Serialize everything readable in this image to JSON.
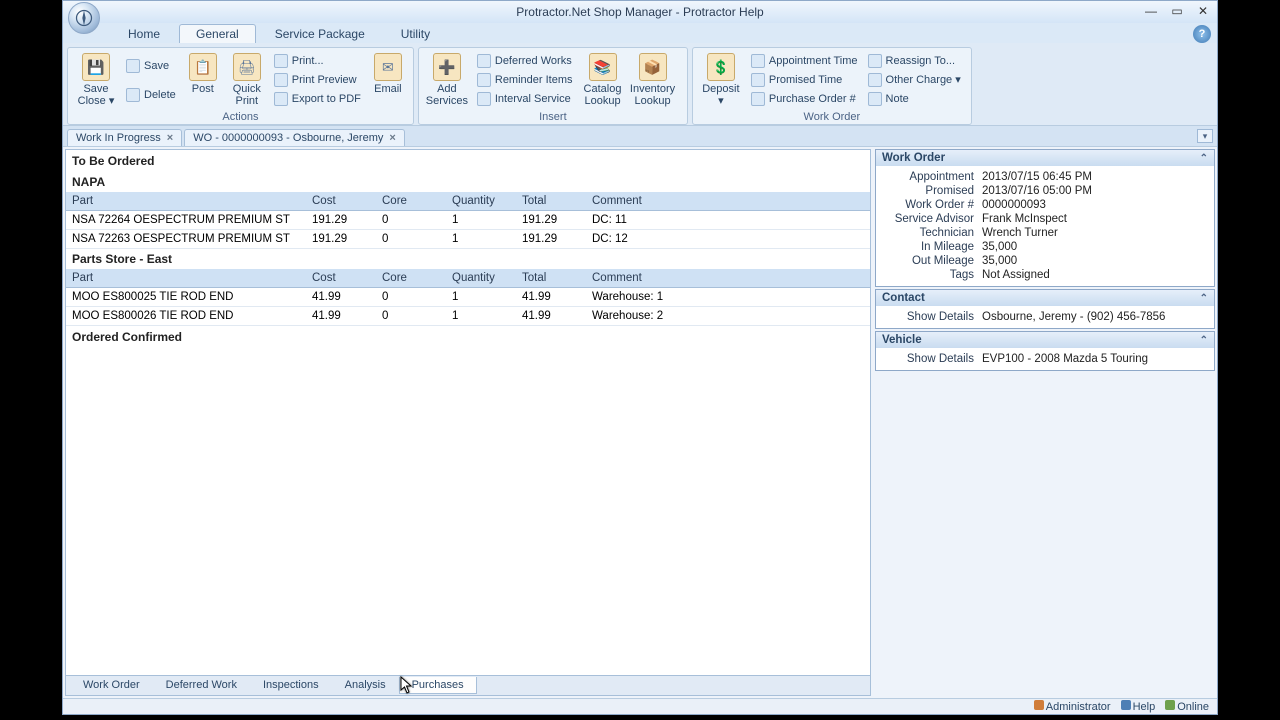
{
  "window": {
    "title": "Protractor.Net Shop Manager - Protractor Help"
  },
  "menuTabs": {
    "items": [
      {
        "label": "Home"
      },
      {
        "label": "General"
      },
      {
        "label": "Service Package"
      },
      {
        "label": "Utility"
      }
    ],
    "activeIndex": 1
  },
  "ribbon": {
    "groups": [
      {
        "label": "Actions",
        "big": [
          {
            "label": "Save Close ▾",
            "name": "save-close-button"
          }
        ],
        "small1": [
          {
            "label": "Save",
            "name": "save-button"
          },
          {
            "label": "Delete",
            "name": "delete-button"
          }
        ],
        "big2": [
          {
            "label": "Post",
            "name": "post-button"
          },
          {
            "label": "Quick Print",
            "name": "quick-print-button"
          }
        ],
        "small2": [
          {
            "label": "Print...",
            "name": "print-button"
          },
          {
            "label": "Print Preview",
            "name": "print-preview-button"
          },
          {
            "label": "Export to PDF",
            "name": "export-pdf-button"
          }
        ],
        "big3": [
          {
            "label": "Email",
            "name": "email-button"
          }
        ]
      },
      {
        "label": "Insert",
        "big": [
          {
            "label": "Add Services",
            "name": "add-services-button"
          }
        ],
        "small1": [
          {
            "label": "Deferred Works",
            "name": "deferred-works-button"
          },
          {
            "label": "Reminder Items",
            "name": "reminder-items-button"
          },
          {
            "label": "Interval Service",
            "name": "interval-service-button"
          }
        ],
        "big2": [
          {
            "label": "Catalog Lookup",
            "name": "catalog-lookup-button"
          },
          {
            "label": "Inventory Lookup",
            "name": "inventory-lookup-button"
          }
        ]
      },
      {
        "label": "Work Order",
        "big": [
          {
            "label": "Deposit ▾",
            "name": "deposit-button"
          }
        ],
        "small1": [
          {
            "label": "Appointment Time",
            "name": "appointment-time-button"
          },
          {
            "label": "Promised Time",
            "name": "promised-time-button"
          },
          {
            "label": "Purchase Order #",
            "name": "purchase-order-button"
          }
        ],
        "small2": [
          {
            "label": "Reassign To...",
            "name": "reassign-button"
          },
          {
            "label": "Other Charge ▾",
            "name": "other-charge-button"
          },
          {
            "label": "Note",
            "name": "note-button"
          }
        ]
      }
    ]
  },
  "docTabs": {
    "items": [
      {
        "label": "Work In Progress"
      },
      {
        "label": "WO - 0000000093 - Osbourne, Jeremy"
      }
    ]
  },
  "left": {
    "section1": "To Be Ordered",
    "suppliers": [
      {
        "name": "NAPA",
        "columns": [
          "Part",
          "Cost",
          "Core",
          "Quantity",
          "Total",
          "Comment"
        ],
        "rows": [
          {
            "part": "NSA 72264 OESPECTRUM PREMIUM ST",
            "cost": "191.29",
            "core": "0",
            "qty": "1",
            "total": "191.29",
            "comment": "DC: 11"
          },
          {
            "part": "NSA 72263 OESPECTRUM PREMIUM ST",
            "cost": "191.29",
            "core": "0",
            "qty": "1",
            "total": "191.29",
            "comment": "DC: 12"
          }
        ]
      },
      {
        "name": "Parts Store - East",
        "columns": [
          "Part",
          "Cost",
          "Core",
          "Quantity",
          "Total",
          "Comment"
        ],
        "rows": [
          {
            "part": "MOO ES800025 TIE ROD END",
            "cost": "41.99",
            "core": "0",
            "qty": "1",
            "total": "41.99",
            "comment": "Warehouse: 1"
          },
          {
            "part": "MOO ES800026 TIE ROD END",
            "cost": "41.99",
            "core": "0",
            "qty": "1",
            "total": "41.99",
            "comment": "Warehouse: 2"
          }
        ]
      }
    ],
    "section2": "Ordered Confirmed"
  },
  "bottomTabs": {
    "items": [
      {
        "label": "Work Order"
      },
      {
        "label": "Deferred Work"
      },
      {
        "label": "Inspections"
      },
      {
        "label": "Analysis"
      },
      {
        "label": "Purchases"
      }
    ],
    "activeIndex": 4
  },
  "right": {
    "workOrder": {
      "title": "Work Order",
      "fields": [
        {
          "k": "Appointment",
          "v": "2013/07/15 06:45 PM"
        },
        {
          "k": "Promised",
          "v": "2013/07/16 05:00 PM"
        },
        {
          "k": "Work Order #",
          "v": "0000000093"
        },
        {
          "k": "Service Advisor",
          "v": "Frank McInspect"
        },
        {
          "k": "Technician",
          "v": "Wrench Turner"
        },
        {
          "k": "In Mileage",
          "v": "35,000"
        },
        {
          "k": "Out Mileage",
          "v": "35,000"
        },
        {
          "k": "Tags",
          "v": "Not Assigned"
        }
      ]
    },
    "contact": {
      "title": "Contact",
      "showDetails": "Show Details",
      "value": "Osbourne, Jeremy - (902) 456-7856"
    },
    "vehicle": {
      "title": "Vehicle",
      "showDetails": "Show Details",
      "value": "EVP100 - 2008 Mazda 5 Touring"
    }
  },
  "statusbar": {
    "user": "Administrator",
    "help": "Help",
    "online": "Online"
  }
}
